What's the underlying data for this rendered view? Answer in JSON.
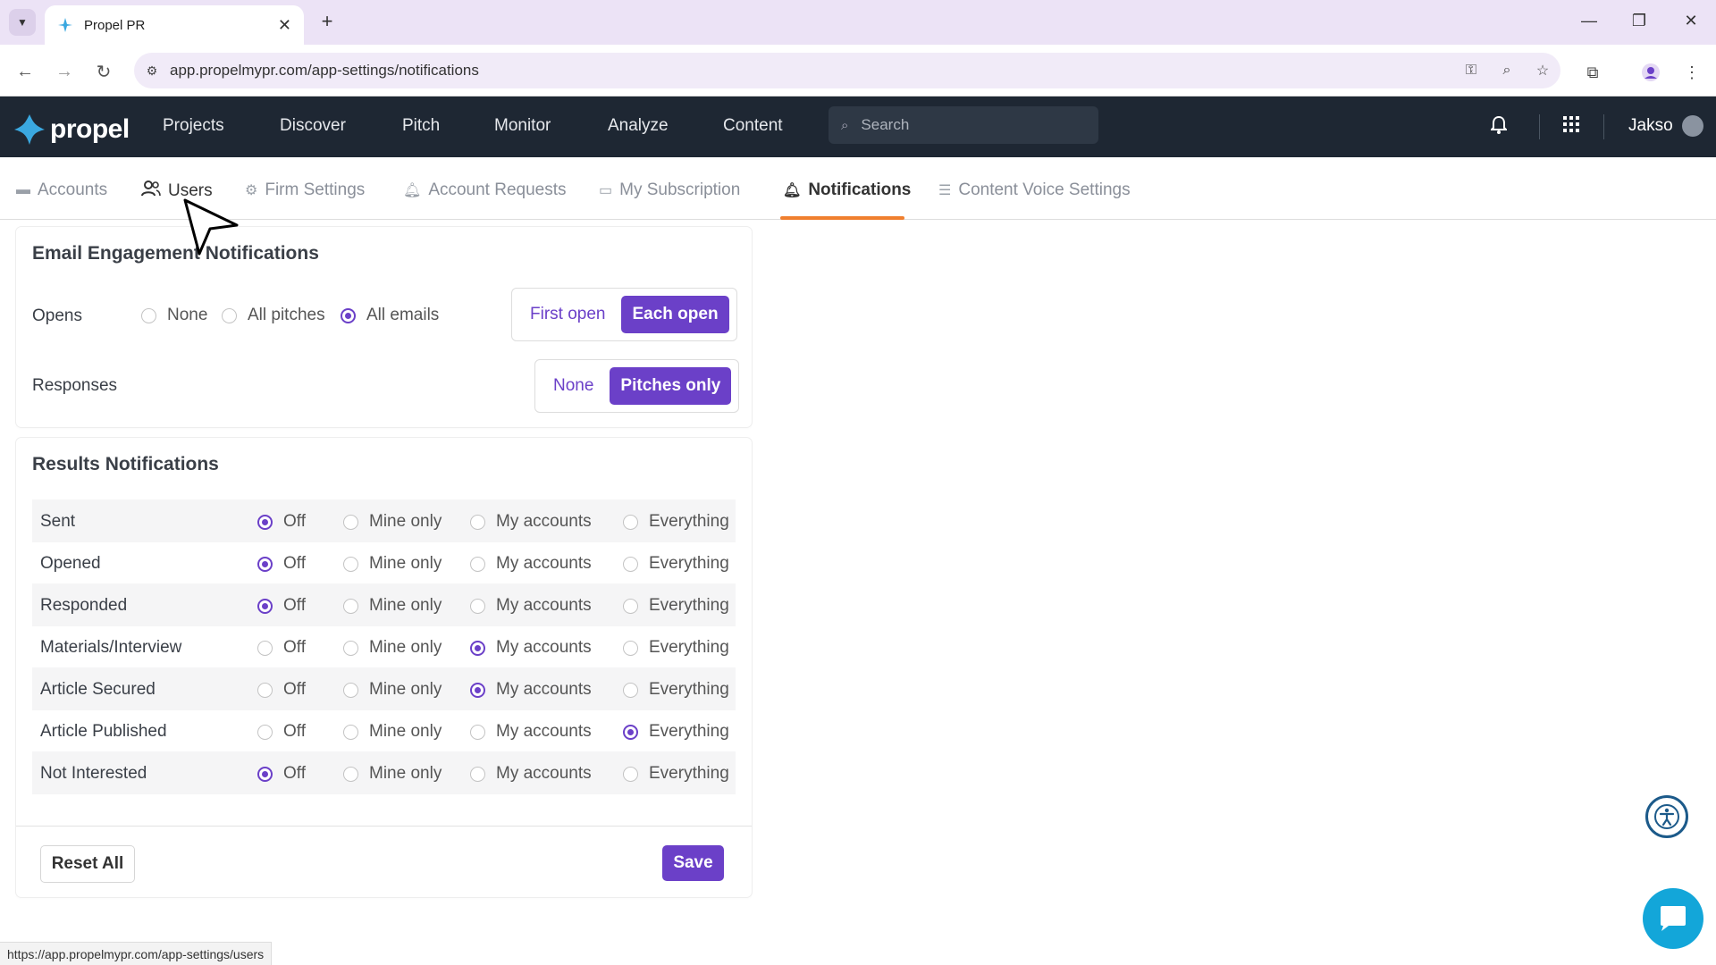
{
  "browser": {
    "tab_title": "Propel PR",
    "url": "app.propelmypr.com/app-settings/notifications",
    "status_url": "https://app.propelmypr.com/app-settings/users"
  },
  "app": {
    "logo_text": "propel",
    "menu": [
      "Projects",
      "Discover",
      "Pitch",
      "Monitor",
      "Analyze",
      "Content"
    ],
    "search_placeholder": "Search",
    "user_name": "Jakso",
    "accent_color": "#6b40c8",
    "nav_bg": "#1e2733"
  },
  "settings_tabs": [
    {
      "label": "Accounts",
      "icon": "card-icon"
    },
    {
      "label": "Users",
      "icon": "users-icon"
    },
    {
      "label": "Firm Settings",
      "icon": "gear-icon"
    },
    {
      "label": "Account Requests",
      "icon": "bell-icon"
    },
    {
      "label": "My Subscription",
      "icon": "monitor-icon"
    },
    {
      "label": "Notifications",
      "icon": "bell-icon",
      "active": true
    },
    {
      "label": "Content Voice Settings",
      "icon": "list-icon"
    }
  ],
  "email": {
    "title": "Email Engagement Notifications",
    "opens_label": "Opens",
    "opens_options": [
      "None",
      "All pitches",
      "All emails"
    ],
    "opens_selected": "All emails",
    "opens_mode": [
      "First open",
      "Each open"
    ],
    "opens_mode_selected": "Each open",
    "responses_label": "Responses",
    "responses_mode": [
      "None",
      "Pitches only"
    ],
    "responses_mode_selected": "Pitches only"
  },
  "results": {
    "title": "Results Notifications",
    "options": [
      "Off",
      "Mine only",
      "My accounts",
      "Everything"
    ],
    "rows": [
      {
        "name": "Sent",
        "selected": "Off"
      },
      {
        "name": "Opened",
        "selected": "Off"
      },
      {
        "name": "Responded",
        "selected": "Off"
      },
      {
        "name": "Materials/Interview",
        "selected": "My accounts"
      },
      {
        "name": "Article Secured",
        "selected": "My accounts"
      },
      {
        "name": "Article Published",
        "selected": "Everything"
      },
      {
        "name": "Not Interested",
        "selected": "Off"
      }
    ]
  },
  "actions": {
    "reset_label": "Reset All",
    "save_label": "Save"
  }
}
